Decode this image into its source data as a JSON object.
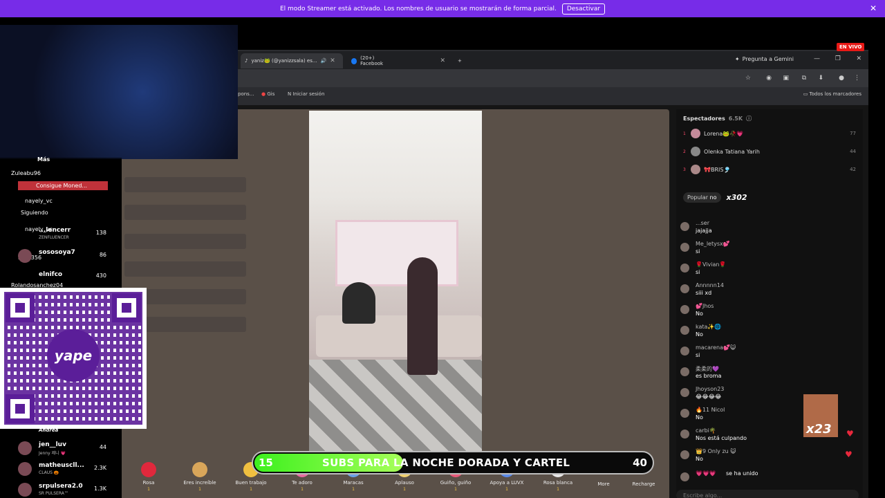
{
  "banner": {
    "text": "El modo Streamer está activado. Los nombres de usuario se mostrarán de forma parcial.",
    "button": "Desactivar",
    "close": "✕"
  },
  "live_badge": "EN VIVO",
  "browser": {
    "tabs": [
      {
        "title": "yaniz🐸 (@yanizzsala) es...",
        "close": "✕"
      },
      {
        "title": "(20+) Facebook",
        "close": "✕"
      }
    ],
    "new_tab": "+",
    "gemini": "Pregunta a Gemini",
    "bookmarks": [
      "pons...",
      "Gis",
      "Iniciar sesión"
    ],
    "all_bookmarks": "Todos los marcadores"
  },
  "viewers": {
    "label": "Espectadores",
    "count": "6.5K",
    "top": [
      {
        "rank": "1",
        "name": "Lorena🐸🥀💗",
        "score": "77"
      },
      {
        "rank": "2",
        "name": "Olenka Tatiana Yarih",
        "score": "44"
      },
      {
        "rank": "3",
        "name": "🎀BRIS🎐",
        "score": "42"
      }
    ]
  },
  "popular": {
    "label": "Popular",
    "badge": "no",
    "multiplier": "x302"
  },
  "comments": [
    {
      "name": "...ser",
      "text": "jajajja"
    },
    {
      "name": "Me_letysx💕",
      "text": "si"
    },
    {
      "name": "🌹Vivian🌹",
      "text": "si"
    },
    {
      "name": "Annnnn14",
      "text": "siii xd"
    },
    {
      "name": "💕Jhos",
      "text": "No"
    },
    {
      "name": "kata✨🌐",
      "text": "No"
    },
    {
      "name": "macarena💕😺",
      "text": "si"
    },
    {
      "name": "柔柔的💜",
      "text": "es broma"
    },
    {
      "name": "Jhoyson23",
      "text": "😂😂😂😂"
    },
    {
      "name": "🔥11 Nicol",
      "text": "No"
    },
    {
      "name": "carbi🌴",
      "text": "Nos está culpando"
    },
    {
      "name": "👑9 Only zu 😺",
      "text": "No"
    },
    {
      "name": "💗💗💗",
      "text": "se ha unido"
    }
  ],
  "chat_input": "Escribe algo...",
  "gifts": [
    {
      "name": "Rosa",
      "coins": "1",
      "color": "#e0283c"
    },
    {
      "name": "Eres increíble",
      "coins": "1",
      "color": "#d9a65a"
    },
    {
      "name": "Buen trabajo",
      "coins": "1",
      "color": "#f0c040"
    },
    {
      "name": "Te adoro",
      "coins": "1",
      "color": "#e86aa0"
    },
    {
      "name": "Maracas",
      "coins": "1",
      "color": "#6aa0e8"
    },
    {
      "name": "Aplauso",
      "coins": "1",
      "color": "#f0d070"
    },
    {
      "name": "Guiño, guiño",
      "coins": "1",
      "color": "#e85a7a"
    },
    {
      "name": "Apoya a LUVX",
      "coins": "1",
      "color": "#5a8ae8"
    },
    {
      "name": "Rosa blanca",
      "coins": "1",
      "color": "#e8e8e8"
    }
  ],
  "more_label": "More",
  "recharge_label": "Recharge",
  "subs_goal": {
    "current": "15",
    "text": "SUBS PARA LA NOCHE DORADA Y CARTEL",
    "target": "40",
    "progress": 0.375
  },
  "overlay_chat": {
    "mas_label": "Más",
    "messages": [
      {
        "name": "Zuleabu96",
        "color": "#9ecbff"
      },
      {
        "name": "Consigue Moned...",
        "color": "#ff7070"
      },
      {
        "name": "nayely_vc",
        "color": "#c7a6ff"
      },
      {
        "name": "Siguiendo",
        "color": "#aaaaaa"
      },
      {
        "name": "nayely_vc",
        "color": "#c7a6ff"
      },
      {
        "name": "Eliz1356",
        "color": "#a0ffb0"
      },
      {
        "name": "Rolandosanchez04",
        "color": "#a0ffb0"
      }
    ],
    "rankings": [
      {
        "name": "...lencerr",
        "sub": "ZENFLUENCER",
        "score": "138"
      },
      {
        "name": "sososoya7",
        "sub": "",
        "score": "86"
      },
      {
        "name": "elnifco",
        "sub": "",
        "score": "430"
      },
      {
        "name": "Andrea",
        "sub": "",
        "score": ""
      },
      {
        "name": "jen__luv",
        "sub": "Jenny 제니 💗",
        "score": "44"
      },
      {
        "name": "matheuscll...",
        "sub": "CLAUS 🎃",
        "score": "2.3K"
      },
      {
        "name": "srpulsera2.0",
        "sub": "SR PULSERA™",
        "score": "1.3K"
      }
    ]
  },
  "qr_brand": "yape",
  "meme_text": "x23"
}
